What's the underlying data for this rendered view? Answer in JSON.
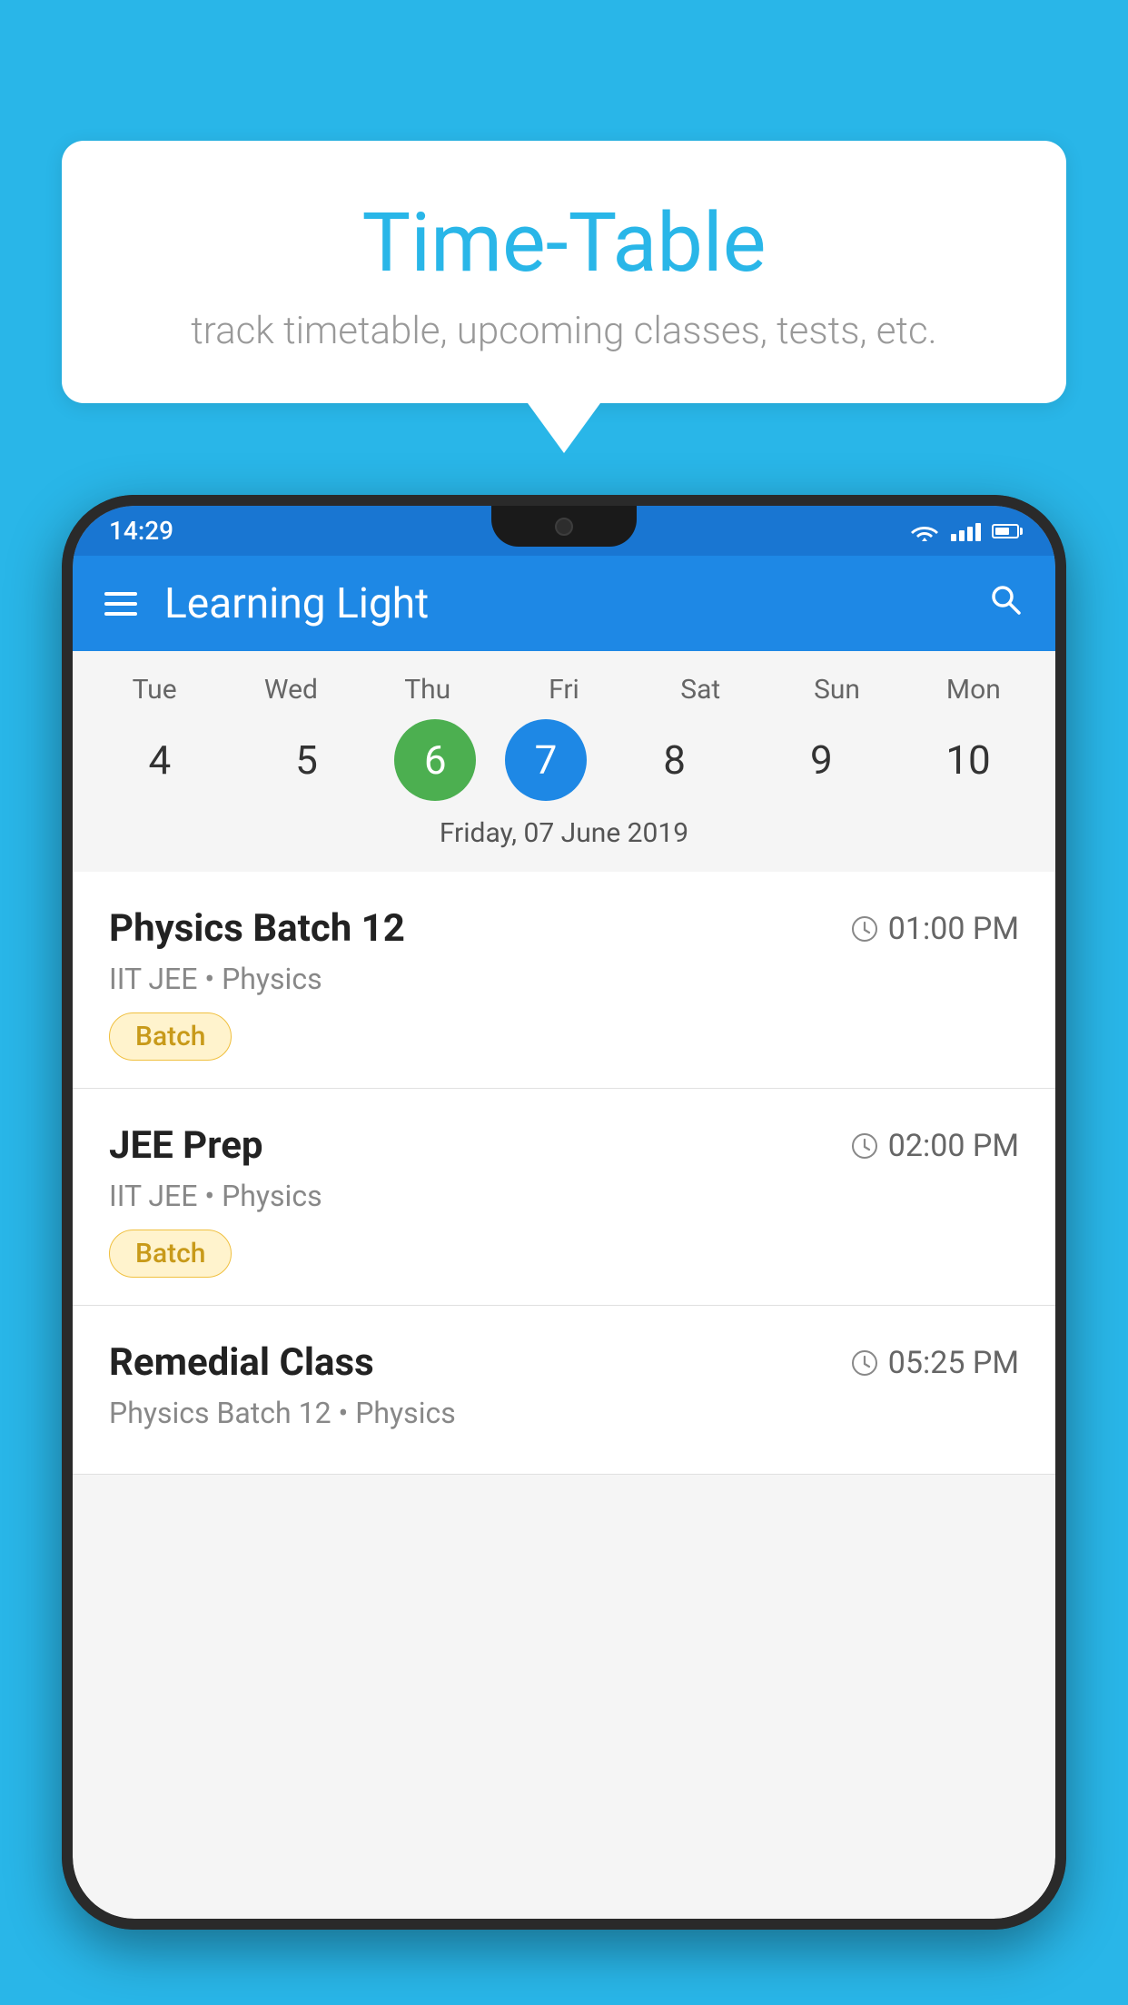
{
  "page": {
    "background_color": "#29b6e8"
  },
  "speech_bubble": {
    "title": "Time-Table",
    "subtitle": "track timetable, upcoming classes, tests, etc."
  },
  "phone": {
    "status_bar": {
      "time": "14:29"
    },
    "app_bar": {
      "title": "Learning Light"
    },
    "calendar": {
      "day_names": [
        "Tue",
        "Wed",
        "Thu",
        "Fri",
        "Sat",
        "Sun",
        "Mon"
      ],
      "dates": [
        "4",
        "5",
        "6",
        "7",
        "8",
        "9",
        "10"
      ],
      "today_index": 2,
      "selected_index": 3,
      "selected_label": "Friday, 07 June 2019"
    },
    "schedule": [
      {
        "title": "Physics Batch 12",
        "time": "01:00 PM",
        "subtitle": "IIT JEE • Physics",
        "badge": "Batch"
      },
      {
        "title": "JEE Prep",
        "time": "02:00 PM",
        "subtitle": "IIT JEE • Physics",
        "badge": "Batch"
      },
      {
        "title": "Remedial Class",
        "time": "05:25 PM",
        "subtitle": "Physics Batch 12 • Physics",
        "badge": ""
      }
    ]
  }
}
